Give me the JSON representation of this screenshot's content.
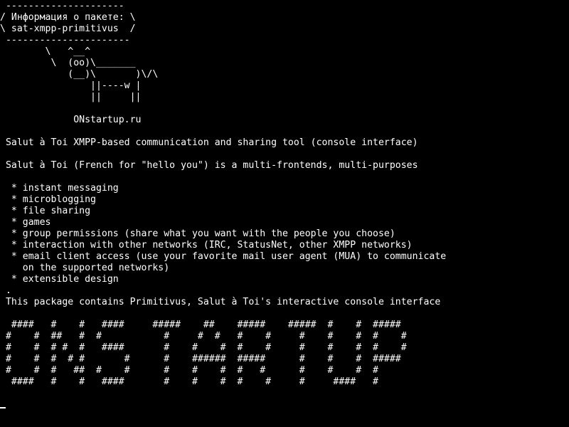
{
  "terminal": {
    "lines": [
      " ---------------------",
      "/ Информация о пакете: \\",
      "\\ sat-xmpp-primitivus  /",
      " ----------------------",
      "        \\   ^__^",
      "         \\  (oo)\\_______",
      "            (__)\\       )\\/\\",
      "                ||----w |",
      "                ||     ||",
      "",
      "             ONstartup.ru",
      "",
      " Salut à Toi XMPP-based communication and sharing tool (console interface)",
      "",
      " Salut à Toi (French for \"hello you\") is a multi-frontends, multi-purposes",
      "",
      "  * instant messaging",
      "  * microblogging",
      "  * file sharing",
      "  * games",
      "  * group permissions (share what you want with the people you choose)",
      "  * interaction with other networks (IRC, StatusNet, other XMPP networks)",
      "  * email client access (use your favorite mail user agent (MUA) to communicate",
      "    on the supported networks)",
      "  * extensible design",
      " .",
      " This package contains Primitivus, Salut à Toi's interactive console interface",
      "",
      "  ####   #    #   ####     #####    ##    #####    #####  #    #  #####",
      " #    #  ##   #  #           #     #  #   #    #     #    #    #  #    #",
      " #    #  # #  #   ####       #    #    #  #    #     #    #    #  #    #",
      " #    #  #  # #       #      #    ######  #####      #    #    #  #####",
      " #    #  #   ##  #    #      #    #    #  #   #      #    #    #  #",
      "  ####   #    #   ####       #    #    #  #    #     #     ####   #"
    ]
  }
}
